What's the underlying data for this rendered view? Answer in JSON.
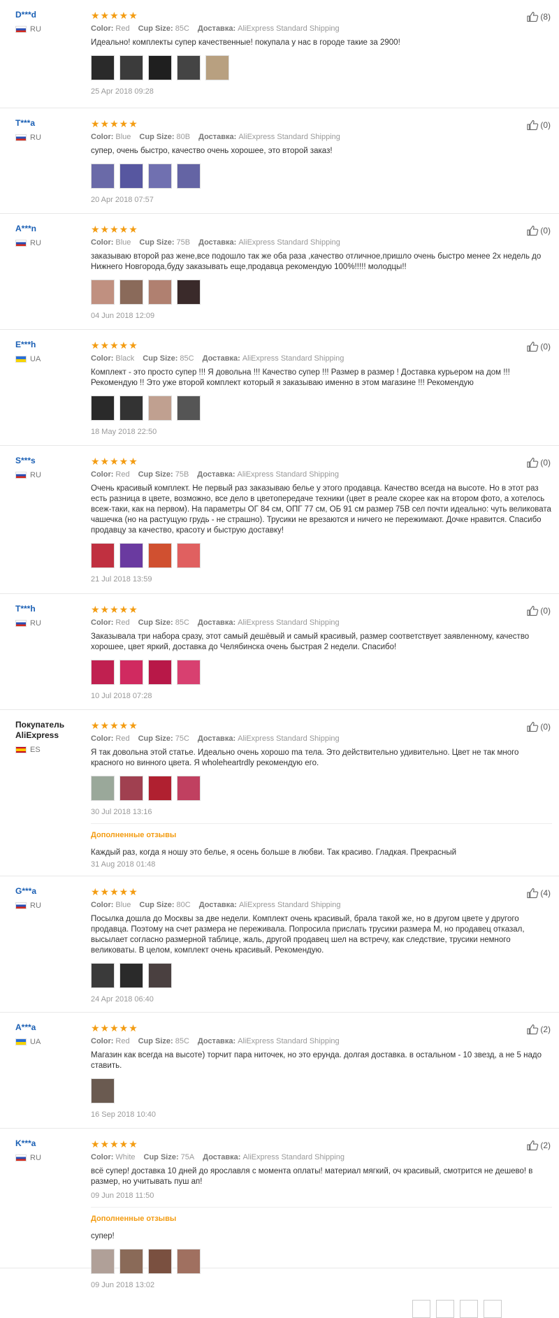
{
  "labels": {
    "color": "Color:",
    "cup_size": "Cup Size:",
    "delivery": "Доставка:",
    "additional": "Дополненные отзывы"
  },
  "stars": "★★★★★",
  "thumb_icon": "thumbs-up-icon",
  "reviews": [
    {
      "user": "D***d",
      "flag": "RU",
      "country": "RU",
      "color": "Red",
      "cup": "85C",
      "shipping": "AliExpress Standard Shipping",
      "text": "Идеально! комплекты супер качественные! покупала у нас в городе такие за 2900!",
      "photos": [
        "#2a2a2a",
        "#3b3b3b",
        "#1f1f1f",
        "#444",
        "#b8a080"
      ],
      "date": "25 Apr 2018 09:28",
      "likes": "(8)"
    },
    {
      "user": "T***a",
      "flag": "RU",
      "country": "RU",
      "color": "Blue",
      "cup": "80B",
      "shipping": "AliExpress Standard Shipping",
      "text": "супер, очень быстро, качество очень хорошее, это второй заказ!",
      "photos": [
        "#6a6aa8",
        "#5757a0",
        "#7070b0",
        "#6464a4"
      ],
      "date": "20 Apr 2018 07:57",
      "likes": "(0)"
    },
    {
      "user": "A***n",
      "flag": "RU",
      "country": "RU",
      "color": "Blue",
      "cup": "75B",
      "shipping": "AliExpress Standard Shipping",
      "text": "заказываю второй раз жене,все подошло так же оба раза ,качество отличное,пришло очень быстро менее 2х недель до Нижнего Новгорода,буду заказывать еще,продавца рекомендую 100%!!!!! молодцы!!",
      "photos": [
        "#c09080",
        "#8a6a5a",
        "#b08070",
        "#3a2a2a"
      ],
      "date": "04 Jun 2018 12:09",
      "likes": "(0)"
    },
    {
      "user": "E***h",
      "flag": "UA",
      "country": "UA",
      "color": "Black",
      "cup": "85C",
      "shipping": "AliExpress Standard Shipping",
      "text": "Комплект - это просто супер !!! Я довольна !!! Качество супер !!! Размер в размер ! Доставка курьером на дом !!! Рекомендую !! Это уже второй комплект который я заказываю именно в этом магазине !!! Рекомендую",
      "photos": [
        "#2a2a2a",
        "#333",
        "#c0a090",
        "#555"
      ],
      "date": "18 May 2018 22:50",
      "likes": "(0)"
    },
    {
      "user": "S***s",
      "flag": "RU",
      "country": "RU",
      "color": "Red",
      "cup": "75B",
      "shipping": "AliExpress Standard Shipping",
      "text": "Очень красивый комплект. Не первый раз заказываю белье у этого продавца. Качество всегда на высоте. Но в этот раз есть разница в цвете, возможно, все дело в цветопередаче техники (цвет в реале скорее как на втором фото, а хотелось всеж-таки, как на первом). На параметры ОГ 84 см, ОПГ 77 см, ОБ 91 см размер 75В сел почти идеально: чуть великовата чашечка (но на растущую грудь - не страшно). Трусики не врезаются и ничего не пережимают. Дочке нравится. Спасибо продавцу за качество, красоту и быструю доставку!",
      "photos": [
        "#c03040",
        "#6a3aa0",
        "#d05030",
        "#e06060"
      ],
      "date": "21 Jul 2018 13:59",
      "likes": "(0)"
    },
    {
      "user": "T***h",
      "flag": "RU",
      "country": "RU",
      "color": "Red",
      "cup": "85C",
      "shipping": "AliExpress Standard Shipping",
      "text": "Заказывала три набора сразу, этот самый дешёвый и самый красивый, размер соответствует заявленному, качество хорошее, цвет яркий, доставка до Челябинска очень быстрая 2 недели. Спасибо!",
      "photos": [
        "#c02050",
        "#d02a60",
        "#b81848",
        "#d84070"
      ],
      "date": "10 Jul 2018 07:28",
      "likes": "(0)"
    },
    {
      "user": "Покупатель AliExpress",
      "flag": "ES",
      "country": "ES",
      "buyer": true,
      "color": "Red",
      "cup": "75C",
      "shipping": "AliExpress Standard Shipping",
      "text": "Я так довольна этой статье. Идеально очень хорошо ma тела. Это действительно удивительно. Цвет не так много красного но винного цвета. Я wholeheartrdly рекомендую его.",
      "photos": [
        "#9aa89a",
        "#a04050",
        "#b02030",
        "#c04060"
      ],
      "date": "30 Jul 2018 13:16",
      "likes": "(0)",
      "additional": {
        "text": "Каждый раз, когда я ношу это белье, я осень больше в любви. Так красиво. Гладкая. Прекрасный",
        "date": "31 Aug 2018 01:48"
      }
    },
    {
      "user": "G***a",
      "flag": "RU",
      "country": "RU",
      "color": "Blue",
      "cup": "80C",
      "shipping": "AliExpress Standard Shipping",
      "text": "Посылка дошла до Москвы за две недели. Комплект очень красивый, брала такой же, но в другом цвете у другого продавца. Поэтому на счет размера не переживала. Попросила прислать трусики размера М, но продавец отказал, высылает согласно размерной таблице, жаль, другой продавец шел на встречу, как следствие, трусики немного великоваты. В целом, комплект очень красивый. Рекомендую.",
      "photos": [
        "#3a3a3a",
        "#2a2a2a",
        "#4a4040"
      ],
      "date": "24 Apr 2018 06:40",
      "likes": "(4)"
    },
    {
      "user": "A***a",
      "flag": "UA",
      "country": "UA",
      "color": "Red",
      "cup": "85C",
      "shipping": "AliExpress Standard Shipping",
      "text": "Магазин как всегда на высоте) торчит пара ниточек, но это ерунда. долгая доставка. в остальном - 10 звезд, а не 5 надо ставить.",
      "photos": [
        "#6a5a50"
      ],
      "date": "16 Sep 2018 10:40",
      "likes": "(2)"
    },
    {
      "user": "K***a",
      "flag": "RU",
      "country": "RU",
      "color": "White",
      "cup": "75A",
      "shipping": "AliExpress Standard Shipping",
      "text": "всё супер! доставка 10 дней до ярославля с момента оплаты! материал мягкий, оч красивый, смотрится не дешево! в размер, но учитывать пуш ап!",
      "photos": [],
      "date": "09 Jun 2018 11:50",
      "likes": "(2)",
      "additional": {
        "text": "супер!",
        "date": "09 Jun 2018 13:02",
        "photos": [
          "#b0a098",
          "#8a6a58",
          "#7a5040",
          "#a07060"
        ]
      }
    }
  ]
}
